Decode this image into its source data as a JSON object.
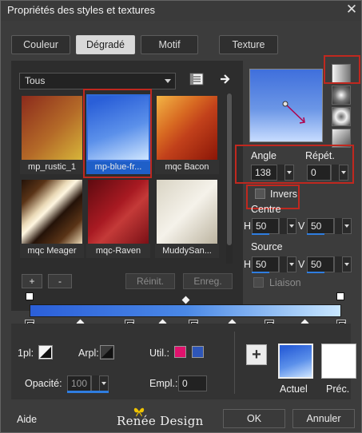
{
  "window": {
    "title": "Propriétés des styles et textures",
    "close_glyph": "✕"
  },
  "tabs": [
    {
      "label": "Couleur",
      "active": false
    },
    {
      "label": "Dégradé",
      "active": true
    },
    {
      "label": "Motif",
      "active": false
    },
    {
      "label": "Texture",
      "active": false
    }
  ],
  "category_select": {
    "value": "Tous"
  },
  "thumbnails": [
    {
      "label": "mp_rustic_1",
      "colors": [
        "#8b2a1c",
        "#b46a28",
        "#d7b63a"
      ]
    },
    {
      "label": "mp-blue-fr...",
      "colors": [
        "#2a5fd8",
        "#5b90ea",
        "#cfe6ff"
      ],
      "selected": true
    },
    {
      "label": "mqc Bacon",
      "colors": [
        "#f3b545",
        "#c2411b",
        "#8b1607"
      ]
    },
    {
      "label": "mqc Meager",
      "colors": [
        "#241208",
        "#e9d8b5",
        "#5a3417"
      ]
    },
    {
      "label": "mqc-Raven",
      "colors": [
        "#5e0a10",
        "#a81a22",
        "#c43a38"
      ]
    },
    {
      "label": "MuddySan...",
      "colors": [
        "#d9d4c4",
        "#f5f2ea",
        "#bcb4a0"
      ]
    }
  ],
  "buttons": {
    "add": "+",
    "remove": "-",
    "reset": "Réinit.",
    "save": "Enreg.",
    "ok": "OK",
    "cancel": "Annuler",
    "help": "Aide",
    "big_plus": "+"
  },
  "gradient": {
    "stop_colors": [
      "#2b5fd9",
      "#4a88e6",
      "#c9e7ff"
    ]
  },
  "angle": {
    "label": "Angle",
    "value": "138"
  },
  "repeat": {
    "label": "Répét.",
    "value": "0"
  },
  "invert": {
    "label": "Invers",
    "checked": false
  },
  "center": {
    "label": "Centre",
    "h_label": "H",
    "h_value": "50",
    "v_label": "V",
    "v_value": "50"
  },
  "source": {
    "label": "Source",
    "h_label": "H",
    "h_value": "50",
    "v_label": "V",
    "v_value": "50"
  },
  "link": {
    "label": "Liaison",
    "checked": false
  },
  "bottom": {
    "fg_label": "1pl:",
    "bg_label": "Arpl:",
    "util_label": "Util.:",
    "util_colors": [
      "#e0126d",
      "#2e56b8"
    ],
    "opacity_label": "Opacité:",
    "opacity_value": "100",
    "location_label": "Empl.:",
    "location_value": "0",
    "current_label": "Actuel",
    "previous_label": "Préc."
  },
  "brand": {
    "text": "Renée Design"
  },
  "accent_red": "#c0281f"
}
